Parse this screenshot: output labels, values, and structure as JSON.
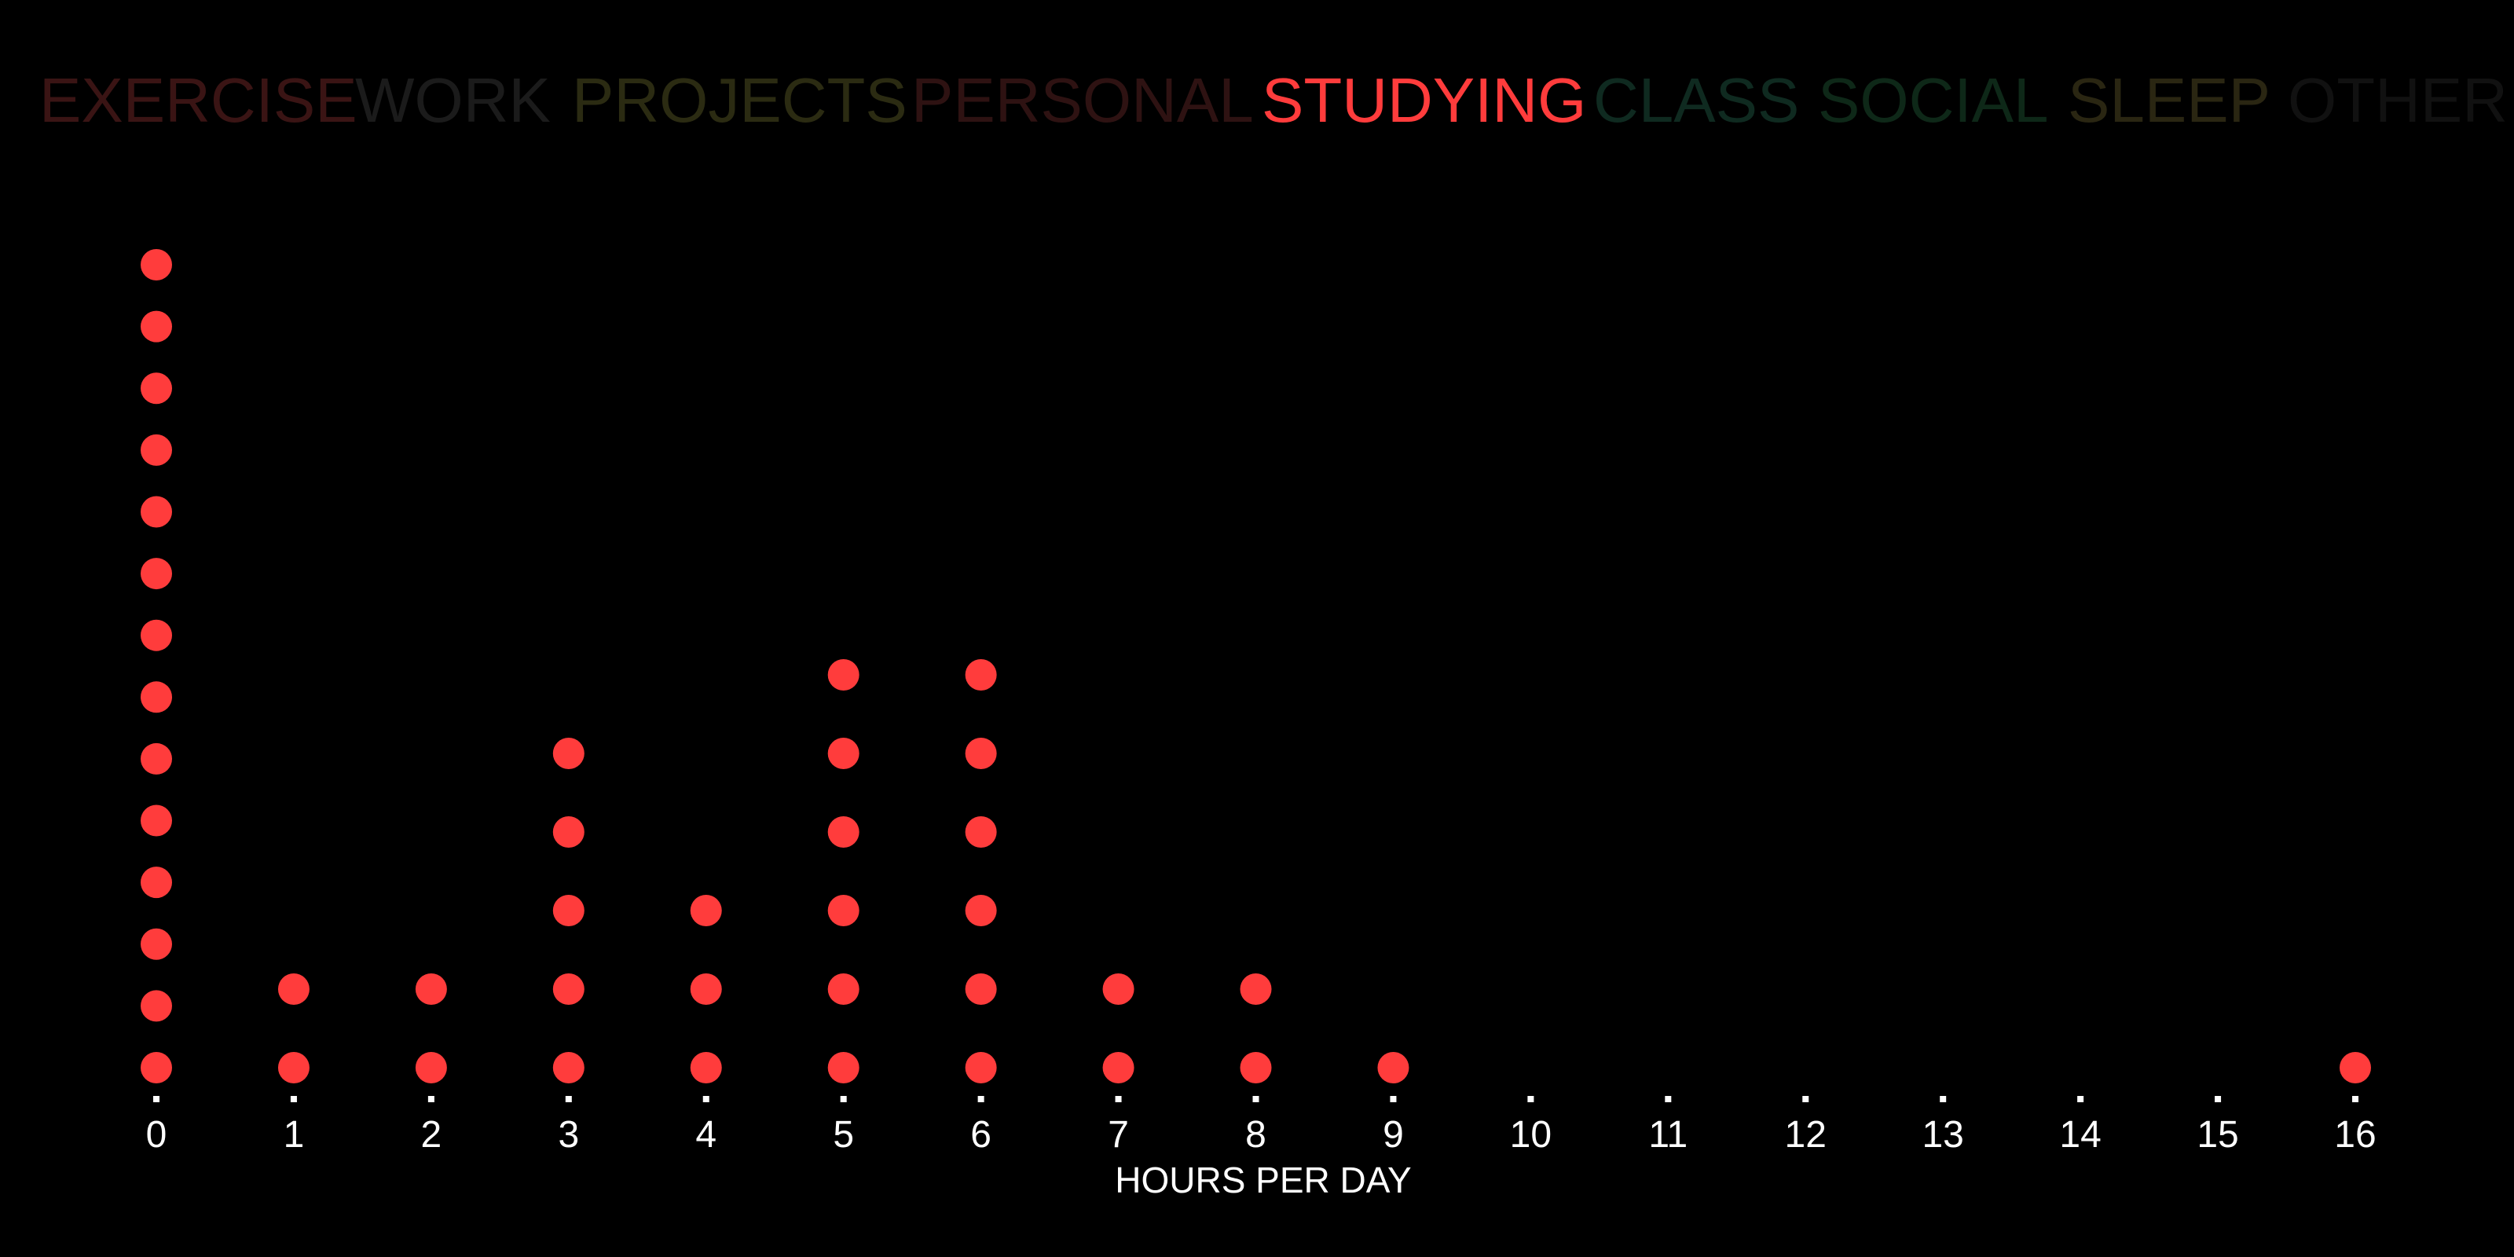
{
  "categories_nav": {
    "items": [
      {
        "label": "EXERCISE",
        "color": "#3a1414",
        "selected": false
      },
      {
        "label": "WORK",
        "color": "#1b1b1b",
        "selected": false
      },
      {
        "label": "PROJECTS",
        "color": "#2b2b12",
        "selected": false
      },
      {
        "label": "PERSONAL",
        "color": "#2e1212",
        "selected": false
      },
      {
        "label": "STUDYING",
        "color": "#ff3c3c",
        "selected": true
      },
      {
        "label": "CLASS",
        "color": "#0f2a20",
        "selected": false
      },
      {
        "label": "SOCIAL",
        "color": "#0e2818",
        "selected": false
      },
      {
        "label": "SLEEP",
        "color": "#2a2612",
        "selected": false
      },
      {
        "label": "OTHER",
        "color": "#111111",
        "selected": false
      }
    ]
  },
  "chart_data": {
    "type": "scatter",
    "subtype": "dot-plot",
    "xlabel": "HOURS PER DAY",
    "ylabel": "",
    "xlim": [
      0,
      16
    ],
    "x": [
      0,
      1,
      2,
      3,
      4,
      5,
      6,
      7,
      8,
      9,
      10,
      11,
      12,
      13,
      14,
      15,
      16
    ],
    "counts": [
      14,
      2,
      2,
      5,
      3,
      6,
      6,
      2,
      2,
      1,
      0,
      0,
      0,
      0,
      0,
      0,
      1
    ],
    "dot_color": "#ff3c3c",
    "axis_color": "#ffffff",
    "grid": false,
    "legend": "none"
  }
}
